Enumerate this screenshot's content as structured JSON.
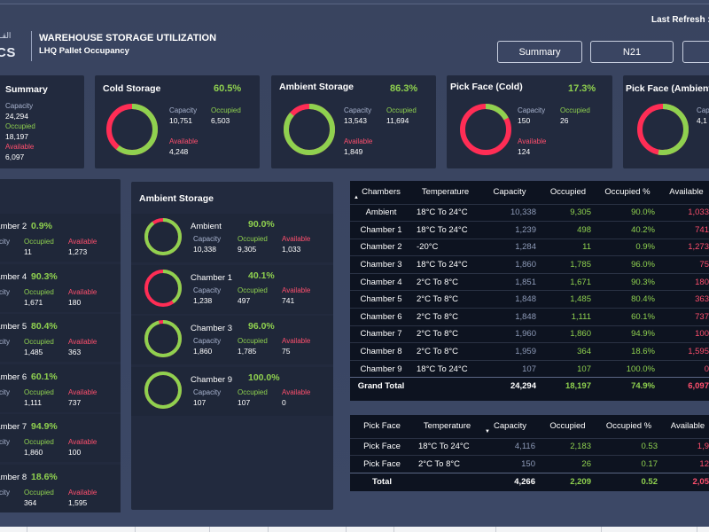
{
  "header": {
    "logo_text": "CS",
    "logo_arabic": "القـ",
    "title": "WAREHOUSE STORAGE UTILIZATION",
    "subtitle": "LHQ Pallet Occupancy",
    "last_refresh": "Last Refresh :",
    "nav": [
      "Summary",
      "N21",
      ""
    ]
  },
  "colors": {
    "occupied": "#8fd14f",
    "available": "#ff2d55",
    "capacity_label": "#a9b4cf",
    "card_bg": "#222a3e"
  },
  "labels": {
    "capacity": "Capacity",
    "occupied": "Occupied",
    "available": "Available"
  },
  "summary_cards": [
    {
      "title": "Summary",
      "pct": "",
      "capacity": "24,294",
      "occupied": "18,197",
      "available": "6,097"
    },
    {
      "title": "Cold Storage",
      "pct": "60.5%",
      "capacity": "10,751",
      "occupied": "6,503",
      "available": "4,248",
      "ratio": 0.605
    },
    {
      "title": "Ambient Storage",
      "pct": "86.3%",
      "capacity": "13,543",
      "occupied": "11,694",
      "available": "1,849",
      "ratio": 0.863
    },
    {
      "title": "Pick Face (Cold)",
      "pct": "17.3%",
      "capacity": "150",
      "occupied": "26",
      "available": "124",
      "ratio": 0.173
    },
    {
      "title": "Pick Face (Ambient)",
      "pct": "",
      "capacity": "4,1",
      "occupied": "",
      "available": "",
      "ratio": 0.53
    }
  ],
  "cold_list": [
    {
      "name": "hamber 2",
      "pct": "0.9%",
      "cap_label": "city",
      "occupied": "11",
      "available": "1,273",
      "ratio": 0.009
    },
    {
      "name": "hamber 4",
      "pct": "90.3%",
      "cap_label": "city",
      "occupied": "1,671",
      "available": "180",
      "ratio": 0.903
    },
    {
      "name": "hamber 5",
      "pct": "80.4%",
      "cap_label": "city",
      "occupied": "1,485",
      "available": "363",
      "ratio": 0.804
    },
    {
      "name": "hamber 6",
      "pct": "60.1%",
      "cap_label": "city",
      "occupied": "1,111",
      "available": "737",
      "ratio": 0.601
    },
    {
      "name": "hamber 7",
      "pct": "94.9%",
      "cap_label": "city",
      "occupied": "1,860",
      "available": "100",
      "ratio": 0.949
    },
    {
      "name": "hamber 8",
      "pct": "18.6%",
      "cap_label": "city",
      "occupied": "364",
      "available": "1,595",
      "ratio": 0.186
    }
  ],
  "ambient_panel": {
    "title": "Ambient Storage",
    "items": [
      {
        "name": "Ambient",
        "pct": "90.0%",
        "capacity": "10,338",
        "occupied": "9,305",
        "available": "1,033",
        "ratio": 0.9
      },
      {
        "name": "Chamber 1",
        "pct": "40.1%",
        "capacity": "1,238",
        "occupied": "497",
        "available": "741",
        "ratio": 0.401
      },
      {
        "name": "Chamber 3",
        "pct": "96.0%",
        "capacity": "1,860",
        "occupied": "1,785",
        "available": "75",
        "ratio": 0.96
      },
      {
        "name": "Chamber 9",
        "pct": "100.0%",
        "capacity": "107",
        "occupied": "107",
        "available": "0",
        "ratio": 1.0
      }
    ]
  },
  "chambers_table": {
    "headers": [
      "Chambers",
      "Temperature",
      "Capacity",
      "Occupied",
      "Occupied %",
      "Available"
    ],
    "rows": [
      [
        "Ambient",
        "18°C To 24°C",
        "10,338",
        "9,305",
        "90.0%",
        "1,033"
      ],
      [
        "Chamber 1",
        "18°C To 24°C",
        "1,239",
        "498",
        "40.2%",
        "741"
      ],
      [
        "Chamber 2",
        "-20°C",
        "1,284",
        "11",
        "0.9%",
        "1,273"
      ],
      [
        "Chamber 3",
        "18°C To 24°C",
        "1,860",
        "1,785",
        "96.0%",
        "75"
      ],
      [
        "Chamber 4",
        "2°C To 8°C",
        "1,851",
        "1,671",
        "90.3%",
        "180"
      ],
      [
        "Chamber 5",
        "2°C To 8°C",
        "1,848",
        "1,485",
        "80.4%",
        "363"
      ],
      [
        "Chamber 6",
        "2°C To 8°C",
        "1,848",
        "1,111",
        "60.1%",
        "737"
      ],
      [
        "Chamber 7",
        "2°C To 8°C",
        "1,960",
        "1,860",
        "94.9%",
        "100"
      ],
      [
        "Chamber 8",
        "2°C To 8°C",
        "1,959",
        "364",
        "18.6%",
        "1,595"
      ],
      [
        "Chamber 9",
        "18°C To 24°C",
        "107",
        "107",
        "100.0%",
        "0"
      ]
    ],
    "total": [
      "Grand Total",
      "",
      "24,294",
      "18,197",
      "74.9%",
      "6,097"
    ]
  },
  "pickface_table": {
    "headers": [
      "Pick Face",
      "Temperature",
      "Capacity",
      "Occupied",
      "Occupied %",
      "Available"
    ],
    "rows": [
      [
        "Pick Face",
        "18°C To 24°C",
        "4,116",
        "2,183",
        "0.53",
        "1,9"
      ],
      [
        "Pick Face",
        "2°C To 8°C",
        "150",
        "26",
        "0.17",
        "12"
      ]
    ],
    "total": [
      "Total",
      "",
      "4,266",
      "2,209",
      "0.52",
      "2,05"
    ]
  }
}
